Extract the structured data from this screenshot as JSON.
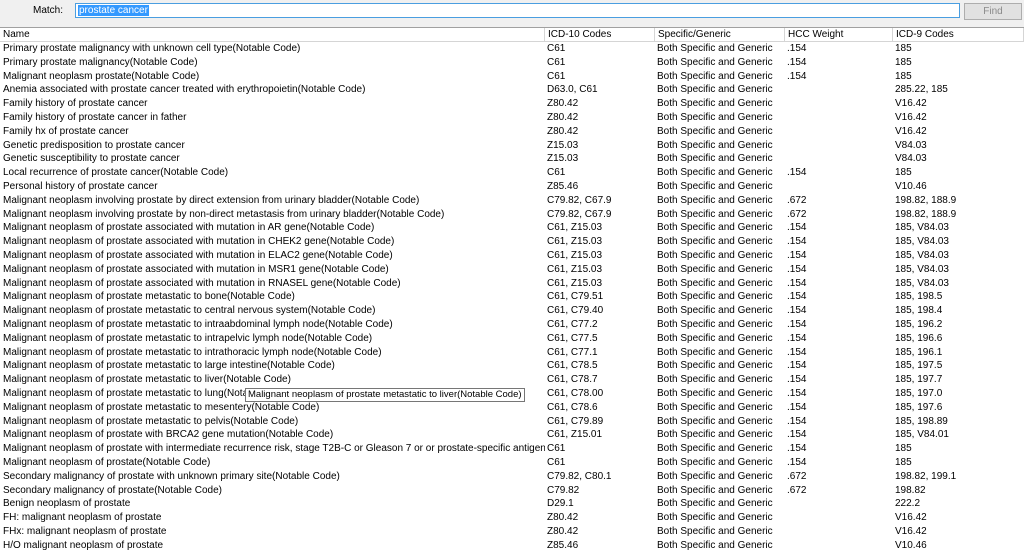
{
  "search": {
    "label": "Match:",
    "value": "prostate cancer",
    "find_label": "Find"
  },
  "columns": [
    "Name",
    "ICD-10 Codes",
    "Specific/Generic",
    "HCC Weight",
    "ICD-9 Codes"
  ],
  "rows": [
    [
      "Primary prostate malignancy with unknown cell type(Notable Code)",
      "C61",
      "Both Specific and Generic",
      ".154",
      "185"
    ],
    [
      "Primary prostate malignancy(Notable Code)",
      "C61",
      "Both Specific and Generic",
      ".154",
      "185"
    ],
    [
      "Malignant neoplasm prostate(Notable Code)",
      "C61",
      "Both Specific and Generic",
      ".154",
      "185"
    ],
    [
      "Anemia associated with prostate cancer treated with erythropoietin(Notable Code)",
      "D63.0, C61",
      "Both Specific and Generic",
      "",
      "285.22, 185"
    ],
    [
      "Family history of prostate cancer",
      "Z80.42",
      "Both Specific and Generic",
      "",
      "V16.42"
    ],
    [
      "Family history of prostate cancer in father",
      "Z80.42",
      "Both Specific and Generic",
      "",
      "V16.42"
    ],
    [
      "Family hx of prostate cancer",
      "Z80.42",
      "Both Specific and Generic",
      "",
      "V16.42"
    ],
    [
      "Genetic predisposition to prostate cancer",
      "Z15.03",
      "Both Specific and Generic",
      "",
      "V84.03"
    ],
    [
      "Genetic susceptibility to prostate cancer",
      "Z15.03",
      "Both Specific and Generic",
      "",
      "V84.03"
    ],
    [
      "Local recurrence of prostate cancer(Notable Code)",
      "C61",
      "Both Specific and Generic",
      ".154",
      "185"
    ],
    [
      "Personal history of prostate cancer",
      "Z85.46",
      "Both Specific and Generic",
      "",
      "V10.46"
    ],
    [
      "Malignant neoplasm involving prostate by direct extension from urinary bladder(Notable Code)",
      "C79.82, C67.9",
      "Both Specific and Generic",
      ".672",
      "198.82, 188.9"
    ],
    [
      "Malignant neoplasm involving prostate by non-direct metastasis from urinary bladder(Notable Code)",
      "C79.82, C67.9",
      "Both Specific and Generic",
      ".672",
      "198.82, 188.9"
    ],
    [
      "Malignant neoplasm of prostate associated with mutation in AR gene(Notable Code)",
      "C61, Z15.03",
      "Both Specific and Generic",
      ".154",
      "185, V84.03"
    ],
    [
      "Malignant neoplasm of prostate associated with mutation in CHEK2 gene(Notable Code)",
      "C61, Z15.03",
      "Both Specific and Generic",
      ".154",
      "185, V84.03"
    ],
    [
      "Malignant neoplasm of prostate associated with mutation in ELAC2 gene(Notable Code)",
      "C61, Z15.03",
      "Both Specific and Generic",
      ".154",
      "185, V84.03"
    ],
    [
      "Malignant neoplasm of prostate associated with mutation in MSR1 gene(Notable Code)",
      "C61, Z15.03",
      "Both Specific and Generic",
      ".154",
      "185, V84.03"
    ],
    [
      "Malignant neoplasm of prostate associated with mutation in RNASEL gene(Notable Code)",
      "C61, Z15.03",
      "Both Specific and Generic",
      ".154",
      "185, V84.03"
    ],
    [
      "Malignant neoplasm of prostate metastatic to bone(Notable Code)",
      "C61, C79.51",
      "Both Specific and Generic",
      ".154",
      "185, 198.5"
    ],
    [
      "Malignant neoplasm of prostate metastatic to central nervous system(Notable Code)",
      "C61, C79.40",
      "Both Specific and Generic",
      ".154",
      "185, 198.4"
    ],
    [
      "Malignant neoplasm of prostate metastatic to intraabdominal lymph node(Notable Code)",
      "C61, C77.2",
      "Both Specific and Generic",
      ".154",
      "185, 196.2"
    ],
    [
      "Malignant neoplasm of prostate metastatic to intrapelvic lymph node(Notable Code)",
      "C61, C77.5",
      "Both Specific and Generic",
      ".154",
      "185, 196.6"
    ],
    [
      "Malignant neoplasm of prostate metastatic to intrathoracic lymph node(Notable Code)",
      "C61, C77.1",
      "Both Specific and Generic",
      ".154",
      "185, 196.1"
    ],
    [
      "Malignant neoplasm of prostate metastatic to large intestine(Notable Code)",
      "C61, C78.5",
      "Both Specific and Generic",
      ".154",
      "185, 197.5"
    ],
    [
      "Malignant neoplasm of prostate metastatic to liver(Notable Code)",
      "C61, C78.7",
      "Both Specific and Generic",
      ".154",
      "185, 197.7"
    ],
    [
      "Malignant neoplasm of prostate metastatic to lung(Notable Code)",
      "C61, C78.00",
      "Both Specific and Generic",
      ".154",
      "185, 197.0"
    ],
    [
      "Malignant neoplasm of prostate metastatic to mesentery(Notable Code)",
      "C61, C78.6",
      "Both Specific and Generic",
      ".154",
      "185, 197.6"
    ],
    [
      "Malignant neoplasm of prostate metastatic to pelvis(Notable Code)",
      "C61, C79.89",
      "Both Specific and Generic",
      ".154",
      "185, 198.89"
    ],
    [
      "Malignant neoplasm of prostate with BRCA2 gene mutation(Notable Code)",
      "C61, Z15.01",
      "Both Specific and Generic",
      ".154",
      "185, V84.01"
    ],
    [
      "Malignant neoplasm of prostate with intermediate recurrence risk, stage T2B-C or Gleason 7 or or prostate-specific antigen (PSA)",
      "C61",
      "Both Specific and Generic",
      ".154",
      "185"
    ],
    [
      "Malignant neoplasm of prostate(Notable Code)",
      "C61",
      "Both Specific and Generic",
      ".154",
      "185"
    ],
    [
      "Secondary malignancy of prostate with unknown primary site(Notable Code)",
      "C79.82, C80.1",
      "Both Specific and Generic",
      ".672",
      "198.82, 199.1"
    ],
    [
      "Secondary malignancy of prostate(Notable Code)",
      "C79.82",
      "Both Specific and Generic",
      ".672",
      "198.82"
    ],
    [
      "Benign neoplasm of prostate",
      "D29.1",
      "Both Specific and Generic",
      "",
      "222.2"
    ],
    [
      "FH: malignant neoplasm of prostate",
      "Z80.42",
      "Both Specific and Generic",
      "",
      "V16.42"
    ],
    [
      "FHx: malignant neoplasm of prostate",
      "Z80.42",
      "Both Specific and Generic",
      "",
      "V16.42"
    ],
    [
      "H/O malignant neoplasm of prostate",
      "Z85.46",
      "Both Specific and Generic",
      "",
      "V10.46"
    ]
  ],
  "tooltip": "Malignant neoplasm of prostate metastatic to liver(Notable Code)"
}
